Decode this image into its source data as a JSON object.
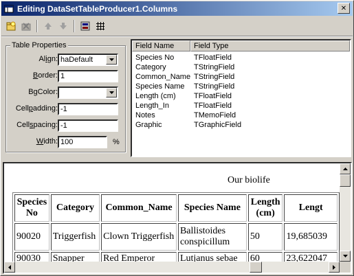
{
  "window": {
    "title": "Editing DataSetTableProducer1.Columns",
    "close_glyph": "✕"
  },
  "toolbar": {
    "buttons": [
      "add-icon",
      "delete-icon",
      "move-up-icon",
      "move-down-icon",
      "properties-icon",
      "grid-icon"
    ]
  },
  "table_properties": {
    "group_title": "Table Properties",
    "align": {
      "label_pre": "Al",
      "label_key": "i",
      "label_post": "gn:",
      "value": "haDefault"
    },
    "border": {
      "label_pre": "",
      "label_key": "B",
      "label_post": "order:",
      "value": "1"
    },
    "bgcolor": {
      "label_pre": "B",
      "label_key": "g",
      "label_post": "Color:",
      "value": ""
    },
    "cellpadding": {
      "label_pre": "Cell",
      "label_key": "p",
      "label_post": "adding:",
      "value": "-1"
    },
    "cellspacing": {
      "label_pre": "Cell",
      "label_key": "s",
      "label_post": "pacing:",
      "value": "-1"
    },
    "width": {
      "label_pre": "",
      "label_key": "W",
      "label_post": "idth:",
      "value": "100",
      "unit": "%"
    }
  },
  "field_list": {
    "headers": [
      "Field Name",
      "Field Type"
    ],
    "rows": [
      [
        "Species No",
        "TFloatField"
      ],
      [
        "Category",
        "TStringField"
      ],
      [
        "Common_Name",
        "TStringField"
      ],
      [
        "Species Name",
        "TStringField"
      ],
      [
        "Length (cm)",
        "TFloatField"
      ],
      [
        "Length_In",
        "TFloatField"
      ],
      [
        "Notes",
        "TMemoField"
      ],
      [
        "Graphic",
        "TGraphicField"
      ]
    ]
  },
  "preview": {
    "caption": "Our biolife",
    "headers": [
      "Species No",
      "Category",
      "Common_Name",
      "Species Name",
      "Length (cm)",
      "Length_In"
    ],
    "header_lines": [
      [
        "Species",
        "No"
      ],
      [
        "Category"
      ],
      [
        "Common_Name"
      ],
      [
        "Species Name"
      ],
      [
        "Length",
        "(cm)"
      ],
      [
        "Lengt"
      ]
    ],
    "rows": [
      {
        "no": "90020",
        "category": "Triggerfish",
        "common": "Clown Triggerfish",
        "species_lines": [
          "Ballistoides",
          "conspicillum"
        ],
        "length": "50",
        "length_in": "19,685039"
      },
      {
        "no": "90030",
        "category": "Snapper",
        "common": "Red Emperor",
        "species_lines": [
          "Lutjanus sebae"
        ],
        "length": "60",
        "length_in": "23,622047"
      }
    ]
  },
  "colors": {
    "title_start": "#0a246a",
    "title_end": "#a6caf0",
    "face": "#d4d0c8"
  }
}
